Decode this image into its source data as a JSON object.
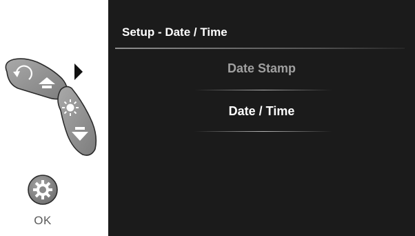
{
  "controls": {
    "up_button_icon": "rotate-up-arrow-icon",
    "down_button_icon": "brightness-down-arrow-icon",
    "ok_button_icon": "gear-icon",
    "ok_label": "OK",
    "pointer_icon": "play-triangle-icon"
  },
  "screen": {
    "title": "Setup - Date / Time",
    "menu": [
      {
        "label": "Date Stamp",
        "selected": false
      },
      {
        "label": "Date / Time",
        "selected": true
      }
    ]
  },
  "colors": {
    "screen_background": "#1b1b1b",
    "text_active": "#ffffff",
    "text_dim": "#a0a0a0",
    "button_fill": "#8c8c8c"
  }
}
